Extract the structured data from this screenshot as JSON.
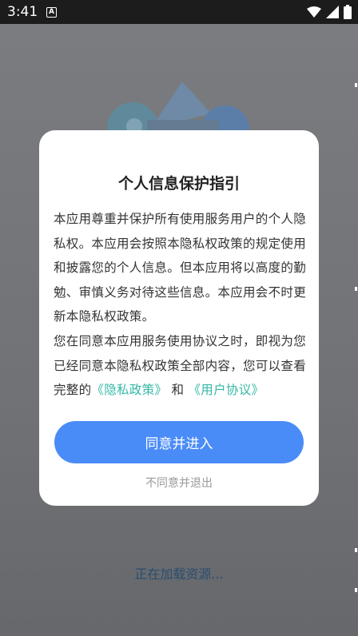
{
  "status_bar": {
    "time": "3:41",
    "notification_badge": "A",
    "icons": [
      "wifi-icon",
      "signal-icon",
      "battery-icon"
    ]
  },
  "background": {
    "loading_text": "正在加载资源..."
  },
  "dialog": {
    "title": "个人信息保护指引",
    "paragraph_1": "本应用尊重并保护所有使用服务用户的个人隐私权。本应用会按照本隐私权政策的规定使用和披露您的个人信息。但本应用将以高度的勤勉、审慎义务对待这些信息。本应用会不时更新本隐私权政策。",
    "paragraph_2_prefix": "您在同意本应用服务使用协议之时，即视为您已经同意本隐私权政策全部内容，您可以查看完整的",
    "privacy_link": "《隐私政策》",
    "connector": "和",
    "terms_link": "《用户协议》",
    "agree_button": "同意并进入",
    "decline_link": "不同意并退出"
  },
  "colors": {
    "primary_button": "#4a8cf7",
    "link": "#34b8a6",
    "loading_text": "#2a4d6e"
  }
}
